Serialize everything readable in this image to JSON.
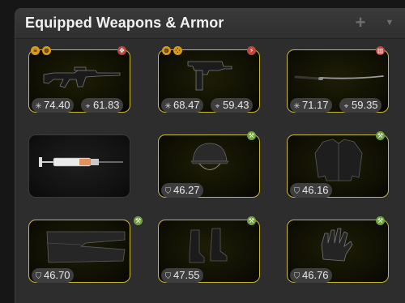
{
  "panel": {
    "title": "Equipped Weapons & Armor",
    "add_button": "+",
    "menu_button": "▼"
  },
  "slots": [
    {
      "name": "assault-rifle",
      "badges": [
        "mod",
        "mod",
        "red"
      ],
      "badge_glyphs": [
        "≡",
        "⊜",
        "✥"
      ],
      "stats": [
        {
          "icon": "damage-icon",
          "glyph": "✳",
          "value": "74.40"
        },
        {
          "icon": "accuracy-icon",
          "glyph": "⌖",
          "value": "61.83"
        }
      ]
    },
    {
      "name": "submachine-gun",
      "badges": [
        "mod",
        "mod",
        "red"
      ],
      "badge_glyphs": [
        "⊜",
        "⁘",
        "⚡"
      ],
      "stats": [
        {
          "icon": "damage-icon",
          "glyph": "✳",
          "value": "68.47"
        },
        {
          "icon": "accuracy-icon",
          "glyph": "⌖",
          "value": "59.43"
        }
      ]
    },
    {
      "name": "katana",
      "badges": [
        "red"
      ],
      "badge_glyphs": [
        "▥"
      ],
      "stats": [
        {
          "icon": "damage-icon",
          "glyph": "✳",
          "value": "71.17"
        },
        {
          "icon": "accuracy-icon",
          "glyph": "⌖",
          "value": "59.35"
        }
      ]
    },
    {
      "name": "syringe",
      "badges": [],
      "badge_glyphs": [],
      "stats": []
    },
    {
      "name": "helmet",
      "badges": [
        "green"
      ],
      "badge_glyphs": [
        "⚒"
      ],
      "stats": [
        {
          "icon": "armor-icon",
          "glyph": "⛉",
          "value": "46.27"
        }
      ]
    },
    {
      "name": "body-armor",
      "badges": [
        "green"
      ],
      "badge_glyphs": [
        "⚒"
      ],
      "stats": [
        {
          "icon": "armor-icon",
          "glyph": "⛉",
          "value": "46.16"
        }
      ]
    },
    {
      "name": "pants",
      "badges": [
        "green"
      ],
      "badge_glyphs": [
        "⚒"
      ],
      "stats": [
        {
          "icon": "armor-icon",
          "glyph": "⛉",
          "value": "46.70"
        }
      ]
    },
    {
      "name": "boots",
      "badges": [
        "green"
      ],
      "badge_glyphs": [
        "⚒"
      ],
      "stats": [
        {
          "icon": "armor-icon",
          "glyph": "⛉",
          "value": "47.55"
        }
      ]
    },
    {
      "name": "gloves",
      "badges": [
        "green"
      ],
      "badge_glyphs": [
        "⚒"
      ],
      "stats": [
        {
          "icon": "armor-icon",
          "glyph": "⛉",
          "value": "46.76"
        }
      ]
    }
  ],
  "colors": {
    "slot_border": "#c9b83a",
    "mod_badge": "#d99a1c",
    "bonus_badge_red": "#c0453a",
    "bonus_badge_green": "#6fa33a"
  }
}
